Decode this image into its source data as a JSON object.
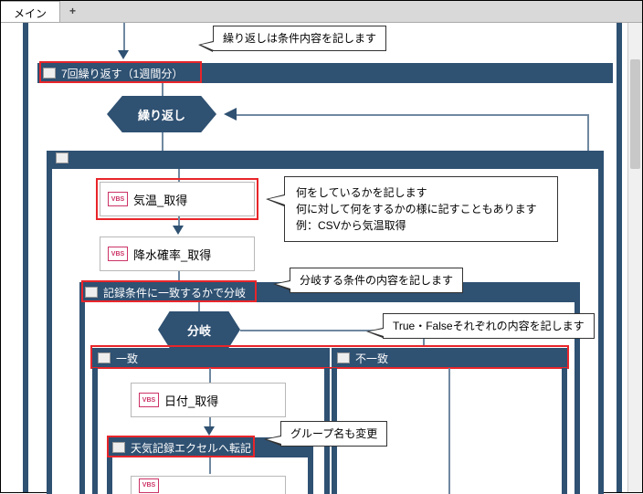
{
  "tabs": {
    "main": "メイン",
    "add": "+"
  },
  "callouts": {
    "repeat": "繰り返しは条件内容を記します",
    "action_l1": "何をしているかを記します",
    "action_l2": "何に対して何をするかの様に記すこともあります",
    "action_l3": "例：CSVから気温取得",
    "branch_condition": "分岐する条件の内容を記します",
    "branch_values": "True・Falseそれぞれの内容を記します",
    "group_name": "グループ名も変更"
  },
  "loop": {
    "header": "7回繰り返す（1週間分）",
    "diamond": "繰り返し"
  },
  "nodes": {
    "temp": "気温_取得",
    "rain": "降水確率_取得",
    "date": "日付_取得"
  },
  "branch": {
    "header": "記録条件に一致するかで分岐",
    "diamond": "分岐",
    "true": "一致",
    "false": "不一致"
  },
  "group": {
    "transfer": "天気記録エクセルへ転記"
  },
  "icons": {
    "vbs": "VBS"
  }
}
